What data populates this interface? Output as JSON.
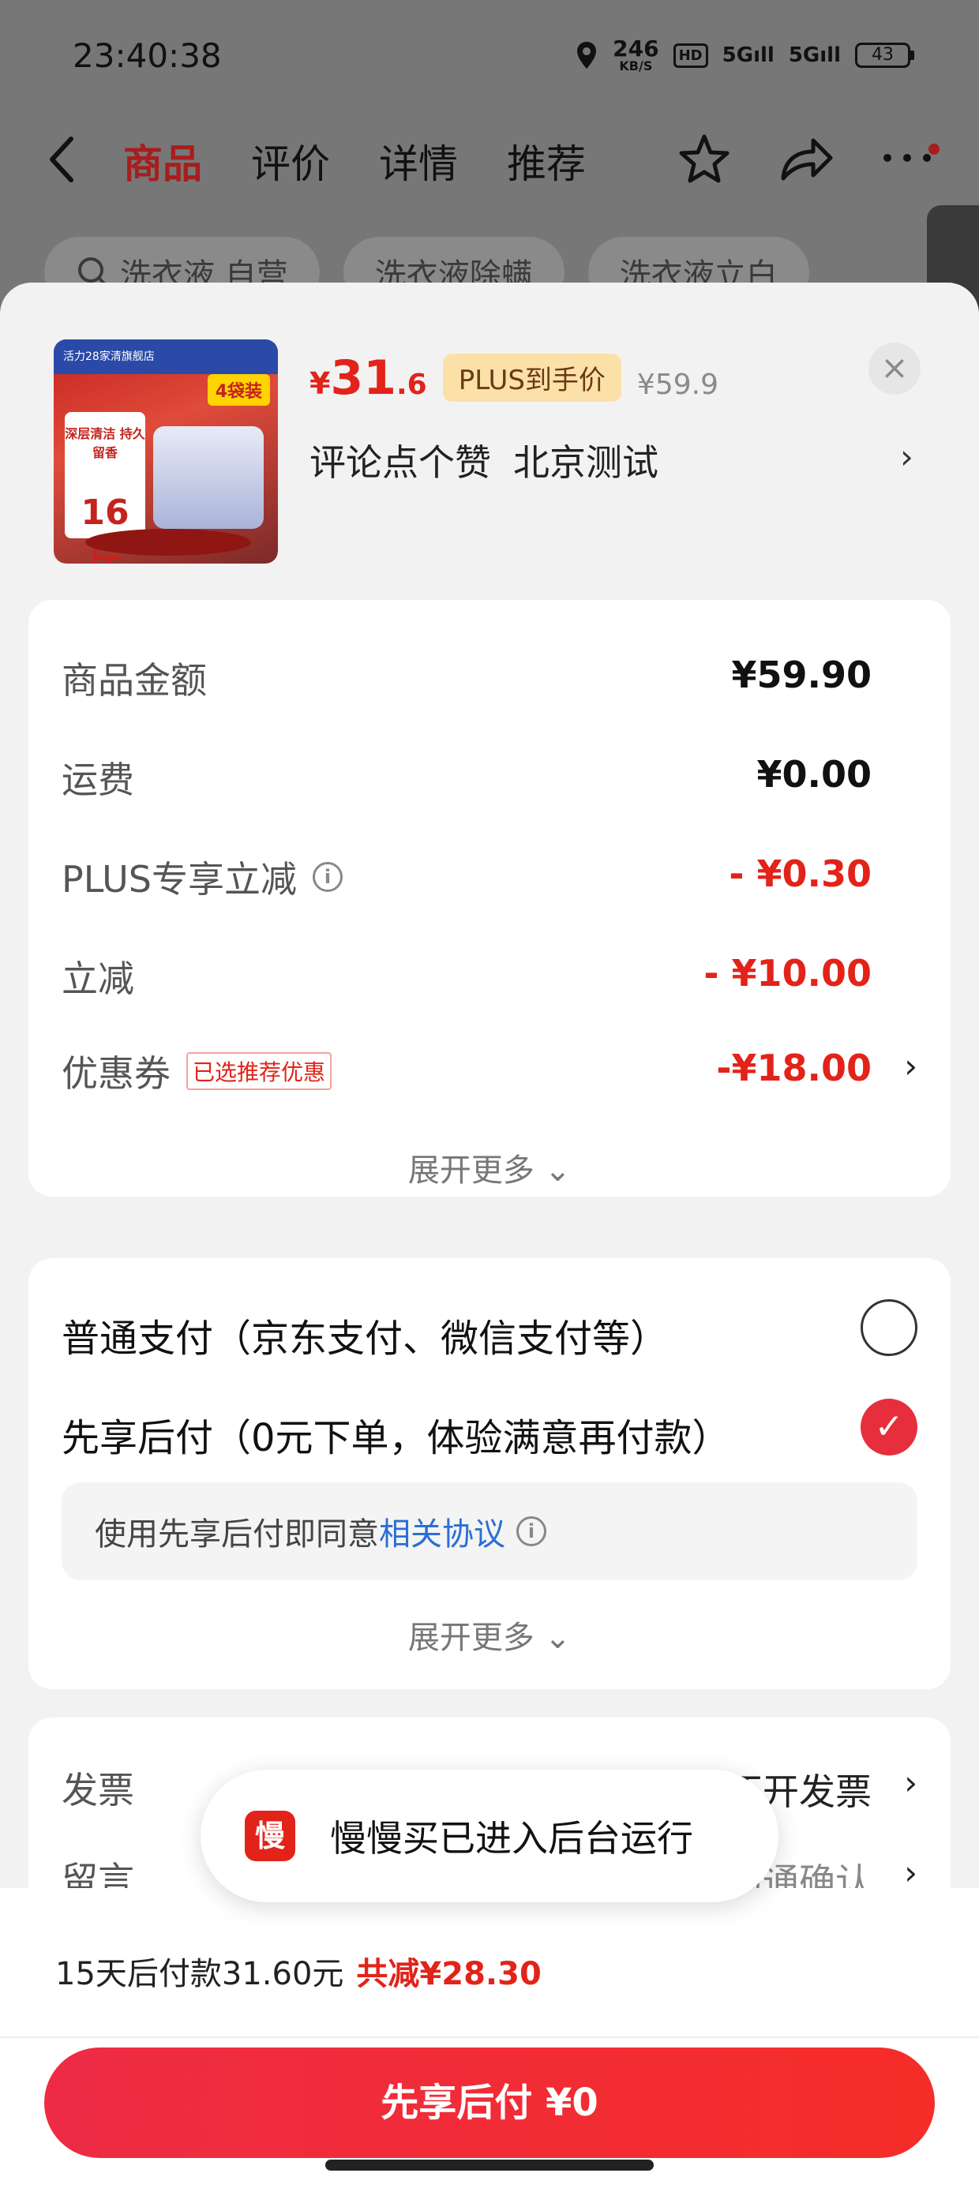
{
  "status_bar": {
    "time": "23:40:38",
    "net_speed": "246",
    "net_unit": "KB/S",
    "hd": "HD",
    "sig1": "5G",
    "sig2": "5G",
    "battery": "43"
  },
  "nav": {
    "tabs": [
      "商品",
      "评价",
      "详情",
      "推荐"
    ]
  },
  "chips": [
    "洗衣液 自营",
    "洗衣液除螨",
    "洗衣液立白"
  ],
  "product": {
    "image_top": "活力28家清旗舰店",
    "image_tag": "4袋装",
    "image_card_l1": "深层清洁 持久留香",
    "image_card_l2": "16斤",
    "price_currency": "¥",
    "price_int": "31",
    "price_dec": ".6",
    "plus_badge": "PLUS到手价",
    "orig_price": "¥59.9",
    "close": "×",
    "address_part1": "评论点个赞",
    "address_part2": "北京测试",
    "chevron": "›"
  },
  "price_rows": {
    "goods": {
      "label": "商品金额",
      "value": "¥59.90"
    },
    "shipping": {
      "label": "运费",
      "value": "¥0.00"
    },
    "plus": {
      "label": "PLUS专享立减",
      "value": "- ¥0.30"
    },
    "discount": {
      "label": "立减",
      "value": "- ¥10.00"
    },
    "coupon": {
      "label": "优惠券",
      "tag": "已选推荐优惠",
      "value": "-¥18.00"
    },
    "expand": "展开更多 ⌄"
  },
  "payment": {
    "normal": "普通支付（京东支付、微信支付等）",
    "later": "先享后付（0元下单，体验满意再付款）",
    "agree_text": "使用先享后付即同意",
    "agree_link": "相关协议",
    "expand": "展开更多 ⌄"
  },
  "invoice": {
    "label": "发票",
    "value": "不开发票",
    "memo_label": "留言",
    "memo_value": "与商家沟通确认"
  },
  "toast": {
    "icon": "慢",
    "text": "慢慢买已进入后台运行"
  },
  "footer": {
    "pay_later": "15天后付款31.60元",
    "total_saving": "共减¥28.30",
    "cta": "先享后付 ¥0"
  },
  "colors": {
    "accent": "#e2231a",
    "brand_dark": "#a81d1d",
    "link": "#2a6fd6"
  }
}
